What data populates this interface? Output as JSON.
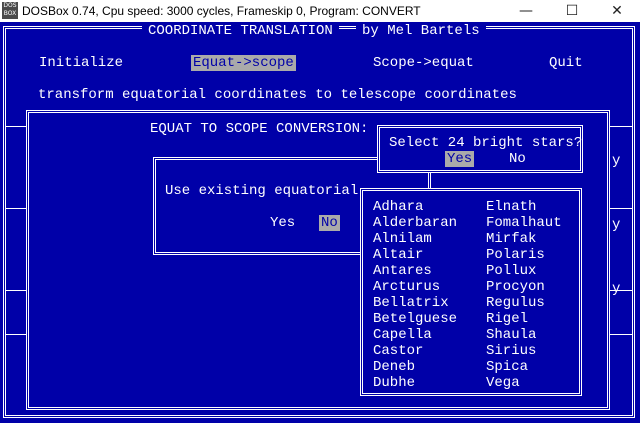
{
  "window": {
    "title": "DOSBox 0.74, Cpu speed:     3000 cycles, Frameskip  0, Program:  CONVERT",
    "icon_text": "DOS BOX",
    "minimize_glyph": "—",
    "maximize_glyph": "☐",
    "close_glyph": "✕"
  },
  "header": {
    "title": "COORDINATE TRANSLATION",
    "author": "by Mel Bartels"
  },
  "menu": {
    "initialize": "Initialize",
    "equat_to_scope": "Equat->scope",
    "scope_to_equat": "Scope->equat",
    "quit": "Quit"
  },
  "description": "transform equatorial coordinates to telescope coordinates",
  "conversion": {
    "title": "EQUAT TO SCOPE CONVERSION:"
  },
  "existing_dialog": {
    "prompt": "Use existing equatorial",
    "yes": "Yes",
    "no": "No"
  },
  "stars_dialog": {
    "prompt": "Select 24 bright stars?",
    "yes": "Yes",
    "no": "No"
  },
  "right_edge": {
    "y1": "y",
    "y2": "y",
    "y3": "y"
  },
  "stars": {
    "col1": [
      "Adhara",
      "Alderbaran",
      "Alnilam",
      "Altair",
      "Antares",
      "Arcturus",
      "Bellatrix",
      "Betelguese",
      "Capella",
      "Castor",
      "Deneb",
      "Dubhe"
    ],
    "col2": [
      "Elnath",
      "Fomalhaut",
      "Mirfak",
      "Polaris",
      "Pollux",
      "Procyon",
      "Regulus",
      "Rigel",
      "Shaula",
      "Sirius",
      "Spica",
      "Vega"
    ]
  },
  "colors": {
    "dos_blue": "#0000a8",
    "dos_white": "#ffffff",
    "highlight": "#aaaaaa"
  }
}
